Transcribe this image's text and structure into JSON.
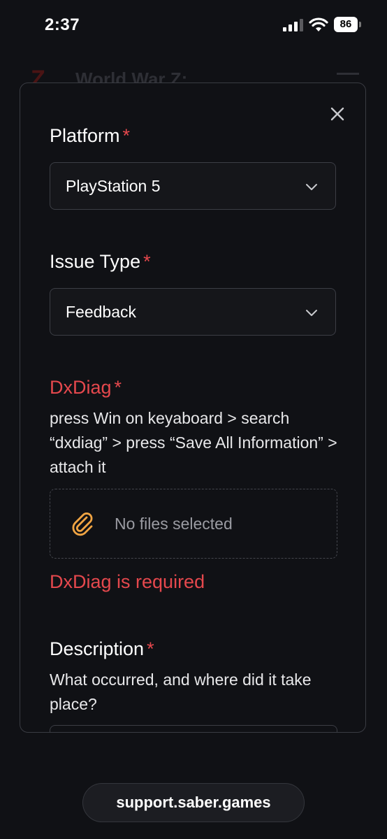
{
  "status_bar": {
    "time": "2:37",
    "battery": "86"
  },
  "background_page": {
    "logo": "Z",
    "title": "World War Z:"
  },
  "form": {
    "platform": {
      "label": "Platform",
      "required_mark": "*",
      "value": "PlayStation 5"
    },
    "issue_type": {
      "label": "Issue Type",
      "required_mark": "*",
      "value": "Feedback"
    },
    "dxdiag": {
      "label": "DxDiag",
      "required_mark": "*",
      "hint": "press Win on keyaboard > search “dxdiag” > press “Save All Information” > attach it",
      "file_text": "No files selected",
      "error": "DxDiag is required"
    },
    "description": {
      "label": "Description",
      "required_mark": "*",
      "hint": "What occurred, and where did it take place?"
    }
  },
  "browser": {
    "url": "support.saber.games"
  },
  "colors": {
    "error": "#e5484d",
    "accent_clip": "#f0a443",
    "background": "#101115"
  }
}
